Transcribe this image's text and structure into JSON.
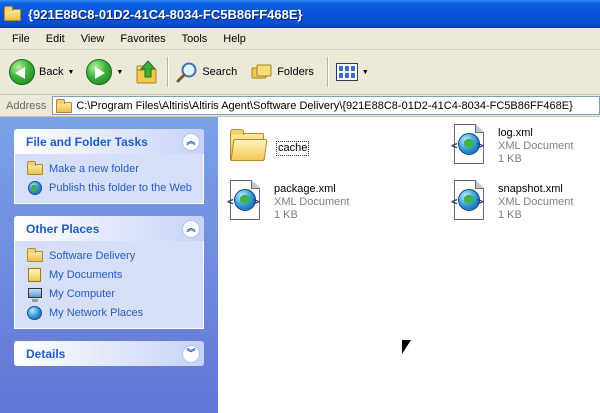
{
  "window": {
    "title": "{921E88C8-01D2-41C4-8034-FC5B86FF468E}"
  },
  "menu": [
    "File",
    "Edit",
    "View",
    "Favorites",
    "Tools",
    "Help"
  ],
  "toolbar": {
    "back_label": "Back",
    "search_label": "Search",
    "folders_label": "Folders"
  },
  "address": {
    "label": "Address",
    "path": "C:\\Program Files\\Altiris\\Altiris Agent\\Software Delivery\\{921E88C8-01D2-41C4-8034-FC5B86FF468E}"
  },
  "left_pane": {
    "file_tasks": {
      "title": "File and Folder Tasks",
      "items": [
        "Make a new folder",
        "Publish this folder to the Web"
      ]
    },
    "other_places": {
      "title": "Other Places",
      "items": [
        "Software Delivery",
        "My Documents",
        "My Computer",
        "My Network Places"
      ]
    },
    "details": {
      "title": "Details"
    }
  },
  "files": [
    {
      "name": "cache",
      "type": "",
      "size": ""
    },
    {
      "name": "log.xml",
      "type": "XML Document",
      "size": "1 KB"
    },
    {
      "name": "package.xml",
      "type": "XML Document",
      "size": "1 KB"
    },
    {
      "name": "snapshot.xml",
      "type": "XML Document",
      "size": "1 KB"
    }
  ],
  "colors": {
    "titlebar": "#0853d6",
    "task_link": "#215dc6",
    "left_pane": "#7ba2e7"
  },
  "icons": [
    "folder-icon",
    "back-arrow-icon",
    "forward-arrow-icon",
    "up-folder-icon",
    "search-icon",
    "folders-icon",
    "views-icon",
    "xml-document-icon",
    "globe-icon",
    "computer-icon",
    "network-icon",
    "chevron-up-icon",
    "chevron-down-icon"
  ]
}
